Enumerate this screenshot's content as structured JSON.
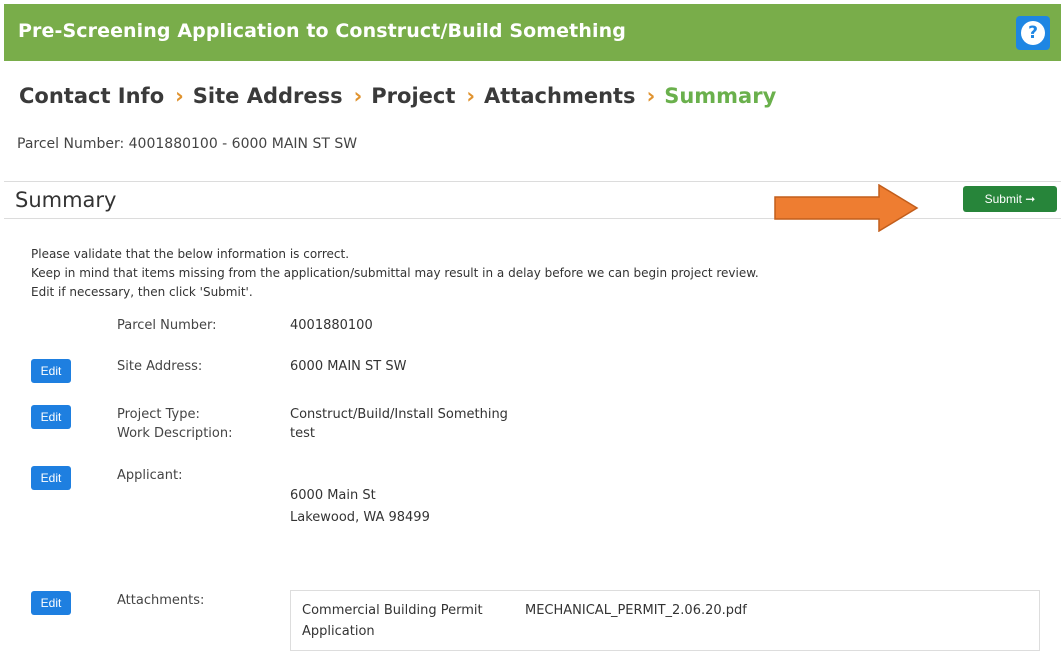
{
  "header": {
    "title": "Pre-Screening Application to Construct/Build Something",
    "help_icon": "question-mark-icon",
    "help_glyph": "?",
    "bg_color": "#79ad4a"
  },
  "breadcrumb": {
    "steps": [
      "Contact Info",
      "Site Address",
      "Project",
      "Attachments",
      "Summary"
    ],
    "separator": "›",
    "active_index": 4,
    "active_color": "#6ab04c",
    "separator_color": "#e0932f"
  },
  "parcel_line": "Parcel Number: 4001880100 - 6000 MAIN ST SW",
  "summary": {
    "title": "Summary",
    "submit_label": "Submit ➞",
    "submit_color": "#27853a"
  },
  "intro": [
    "Please validate that the below information is correct.",
    "Keep in mind that items missing from the application/submittal may result in a delay before we can begin project review.",
    "Edit if necessary, then click 'Submit'."
  ],
  "edit_label": "Edit",
  "fields": {
    "parcel_number": {
      "label": "Parcel Number:",
      "value": "4001880100"
    },
    "site_address": {
      "label": "Site Address:",
      "value": "6000 MAIN ST SW"
    },
    "project_type": {
      "label": "Project Type:",
      "value": "Construct/Build/Install Something"
    },
    "work_description": {
      "label": "Work Description:",
      "value": "test"
    },
    "applicant": {
      "label": "Applicant:",
      "address_line1": "6000 Main St",
      "address_line2": "Lakewood, WA 98499"
    },
    "attachments": {
      "label": "Attachments:",
      "items": [
        {
          "type_line1": "Commercial Building Permit",
          "type_line2": "Application",
          "file": "MECHANICAL_PERMIT_2.06.20.pdf"
        }
      ]
    }
  },
  "annotation_arrow_color": "#ee7d31"
}
